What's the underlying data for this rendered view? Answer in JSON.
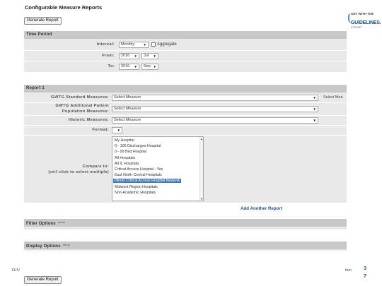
{
  "page": {
    "title": "Configurable Measure Reports",
    "generate_report": "Generate Report"
  },
  "logo": {
    "line1": "GET WITH THE",
    "line2": "GUIDELINES.",
    "line3": "STROKE"
  },
  "time_period": {
    "header": "Time Period",
    "interval_label": "Interval:",
    "interval_value": "Monthly",
    "aggregate_label": "Aggregate",
    "from_label": "From:",
    "from_year": "2016",
    "from_month": "Jul",
    "to_label": "To:",
    "to_year": "2016",
    "to_month": "Sep"
  },
  "report": {
    "header": "Report 1",
    "standard_label": "GWTG Standard Measures:",
    "standard_value": "Select Measure",
    "standard_overflow": "Select Mea",
    "additional_label_1": "GWTG Additional Patient",
    "additional_label_2": "Population Measures:",
    "additional_value": "Select Measure",
    "historic_label": "Historic Measures:",
    "historic_value": "Select Measure",
    "format_label": "Format:",
    "compare_label_1": "Compare to:",
    "compare_label_2": "(ctrl click to select multiple)",
    "compare_options": [
      "My Hospital",
      "0 - 100 Discharges Hospital",
      "0 - 99 Bed Hospital",
      "All Hospitals",
      "All IL Hospitals",
      "Critical Access Hospital - Yes",
      "East North Central Hospitals",
      "Illinois Critical Access Hospital Network",
      "Midwest Region Hospitals",
      "Non-Academic Hospitals"
    ],
    "selected_index": 7,
    "add_another": "Add Another Report"
  },
  "filter_options": {
    "header": "Filter Options",
    "show": "show"
  },
  "display_options": {
    "header": "Display Options",
    "show": "show"
  },
  "footer": {
    "left_text": "11/1/",
    "right_text": "tion",
    "page_num_1": "3",
    "page_num_2": "7"
  }
}
